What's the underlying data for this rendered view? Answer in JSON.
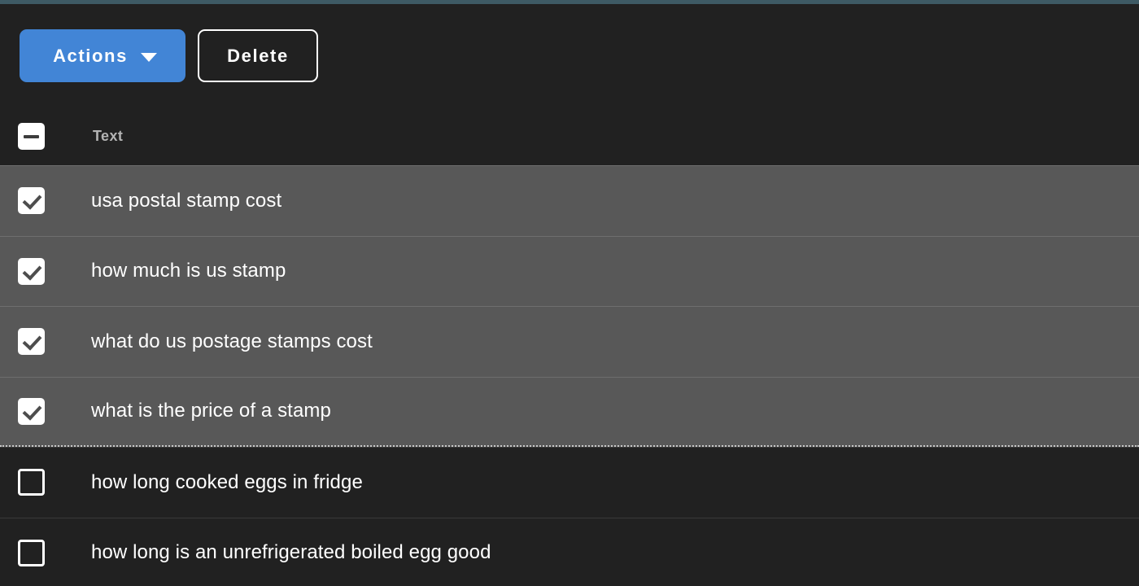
{
  "window": {
    "accent_strip_color": "#3e5a64",
    "background_color": "#212121",
    "selected_row_color": "#585858"
  },
  "toolbar": {
    "actions_label": "Actions",
    "actions_color": "#4285d6",
    "actions_caret_icon": "chevron-down-icon",
    "delete_label": "Delete"
  },
  "table": {
    "header": {
      "select_all_state": "indeterminate",
      "column_text": "Text"
    },
    "rows": [
      {
        "text": "usa postal stamp cost",
        "checked": true
      },
      {
        "text": "how much is us stamp",
        "checked": true
      },
      {
        "text": "what do us postage stamps cost",
        "checked": true
      },
      {
        "text": "what is the price of a stamp",
        "checked": true
      },
      {
        "text": "how long cooked eggs in fridge",
        "checked": false
      },
      {
        "text": "how long is an unrefrigerated boiled egg good",
        "checked": false
      }
    ]
  }
}
